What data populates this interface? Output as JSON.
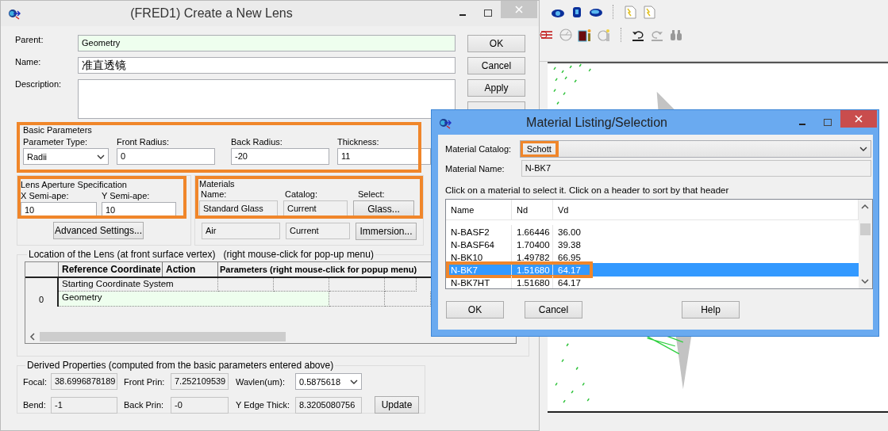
{
  "lens_dialog": {
    "title": "(FRED1) Create a New Lens",
    "fields": [
      {
        "label": "Parent:",
        "value": "Geometry",
        "kind": "parent"
      },
      {
        "label": "Name:",
        "value": "准直透镜",
        "kind": "text"
      },
      {
        "label": "Description:",
        "kind": "multiline"
      }
    ],
    "buttons": [
      "OK",
      "Cancel",
      "Apply"
    ],
    "basic_parameters": {
      "title": "Basic Parameters",
      "highlighted": true,
      "parameter_type": {
        "label": "Parameter Type:",
        "value": "Radii"
      },
      "front_radius": {
        "label": "Front Radius:",
        "value": "0"
      },
      "back_radius": {
        "label": "Back Radius:",
        "value": "-20"
      },
      "thickness": {
        "label": "Thickness:",
        "value": "11"
      }
    },
    "aperture": {
      "title": "Lens Aperture Specification",
      "highlighted": true,
      "x_semi_ape": {
        "label": "X Semi-ape:",
        "value": "10"
      },
      "y_semi_ape": {
        "label": "Y Semi-ape:",
        "value": "10"
      },
      "advanced_button": "Advanced Settings..."
    },
    "materials": {
      "title": "Materials",
      "highlighted": true,
      "headers": [
        "Name:",
        "Catalog:",
        "Select:"
      ],
      "rows": [
        {
          "name": "Standard Glass",
          "catalog": "Current",
          "button": "Glass..."
        },
        {
          "name": "Air",
          "catalog": "Current",
          "button": "Immersion..."
        }
      ]
    },
    "location": {
      "title": "Location of the Lens (at front surface vertex)",
      "hint": "(right mouse-click for pop-up menu)",
      "columns": [
        "Reference Coordinate",
        "Action",
        "Parameters (right mouse-click for popup menu)"
      ],
      "rows": [
        {
          "reference": "Starting Coordinate System",
          "selected": false
        },
        {
          "row_header": "0",
          "reference": "Geometry",
          "selected": true
        }
      ]
    },
    "derived": {
      "title": "Derived Properties (computed from the basic parameters entered above)",
      "focal": {
        "label": "Focal:",
        "value": "38.6996878189"
      },
      "front_prin": {
        "label": "Front Prin:",
        "value": "7.252109539"
      },
      "wavlen": {
        "label": "Wavlen(um):",
        "value": "0.5875618"
      },
      "bend": {
        "label": "Bend:",
        "value": "-1"
      },
      "back_prin": {
        "label": "Back Prin:",
        "value": "-0"
      },
      "y_edge_thick": {
        "label": "Y Edge Thick:",
        "value": "8.3205080756"
      },
      "update_button": "Update"
    }
  },
  "material_dialog": {
    "title": "Material Listing/Selection",
    "catalog": {
      "label": "Material Catalog:",
      "value": "Schott",
      "highlighted": true
    },
    "material_name": {
      "label": "Material Name:",
      "value": "N-BK7"
    },
    "instructions": "Click on a material to select it. Click on a header to sort by that header",
    "table": {
      "columns": [
        "Name",
        "Nd",
        "Vd"
      ],
      "rows": [
        {
          "name": "N-BASF2",
          "nd": "1.66446",
          "vd": "36.00",
          "selected": false,
          "highlighted": false
        },
        {
          "name": "N-BASF64",
          "nd": "1.70400",
          "vd": "39.38",
          "selected": false,
          "highlighted": false
        },
        {
          "name": "N-BK10",
          "nd": "1.49782",
          "vd": "66.95",
          "selected": false,
          "highlighted": false
        },
        {
          "name": "N-BK7",
          "nd": "1.51680",
          "vd": "64.17",
          "selected": true,
          "highlighted": true
        },
        {
          "name": "N-BK7HT",
          "nd": "1.51680",
          "vd": "64.17",
          "selected": false,
          "highlighted": false
        }
      ]
    },
    "buttons": [
      "OK",
      "Cancel",
      "Help"
    ]
  }
}
